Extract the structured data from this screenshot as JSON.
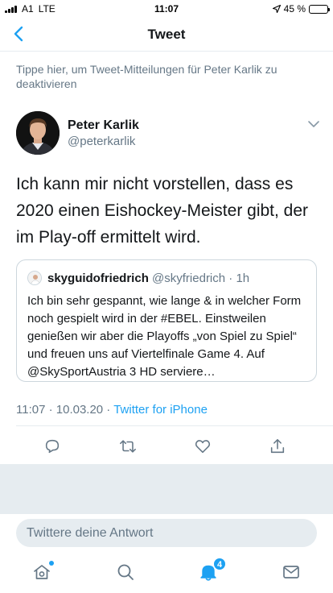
{
  "status_bar": {
    "carrier": "A1",
    "network": "LTE",
    "time": "11:07",
    "battery": "45 %",
    "battery_level": 0.45
  },
  "nav": {
    "title": "Tweet",
    "back_icon": "chevron-left-icon"
  },
  "notification_hint": "Tippe hier, um Tweet-Mitteilungen für Peter Karlik zu deaktivieren",
  "tweet": {
    "author_name": "Peter Karlik",
    "author_handle": "@peterkarlik",
    "text": "Ich kann mir nicht vorstellen, dass es 2020 einen Eishockey-Meister gibt, der im Play-off ermittelt wird.",
    "date": "11:07 · 10.03.20 · ",
    "source": "Twitter for iPhone"
  },
  "quoted_tweet": {
    "author_name": "skyguidofriedrich",
    "author_handle": "@skyfriedrich",
    "age": "· 1h",
    "text": "Ich bin sehr gespannt, wie lange & in welcher Form noch gespielt wird in der #EBEL. Einstweilen genießen wir aber die Playoffs „von Spiel zu Spiel“ und freuen uns auf Viertelfinale Game 4. Auf @SkySportAustria 3 HD serviere…"
  },
  "actions": [
    "reply-icon",
    "retweet-icon",
    "like-icon",
    "share-icon"
  ],
  "reply": {
    "placeholder": "Twittere deine Antwort"
  },
  "tab_bar": {
    "items": [
      "home-icon",
      "search-icon",
      "notifications-icon",
      "messages-icon"
    ],
    "notification_count": "4"
  },
  "colors": {
    "accent": "#1da1f2",
    "secondary_text": "#657786",
    "border": "#e6ecf0"
  }
}
